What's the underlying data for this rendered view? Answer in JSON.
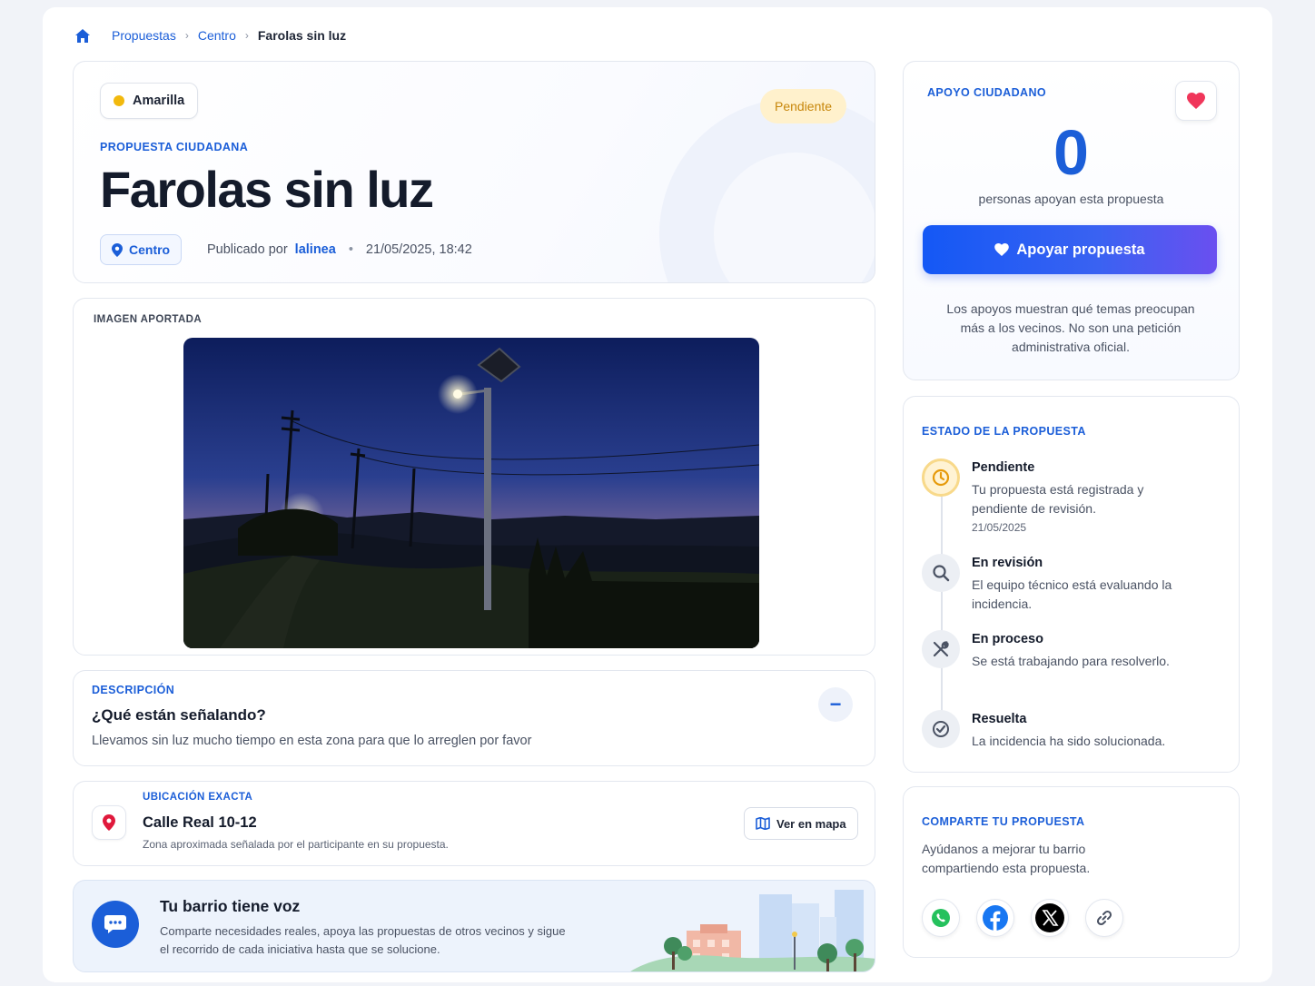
{
  "breadcrumb": {
    "items": [
      "Propuestas",
      "Centro"
    ],
    "current": "Farolas sin luz"
  },
  "proposal": {
    "category": "Amarilla",
    "category_color": "#f2b90d",
    "status_badge": "Pendiente",
    "eyebrow": "PROPUESTA CIUDADANA",
    "title": "Farolas sin luz",
    "district": "Centro",
    "published_prefix": "Publicado por",
    "author": "lalinea",
    "date": "21/05/2025, 18:42"
  },
  "image_section": {
    "eyebrow": "IMAGEN APORTADA"
  },
  "description": {
    "eyebrow": "DESCRIPCIÓN",
    "heading": "¿Qué están señalando?",
    "text": "Llevamos sin luz mucho tiempo en esta zona para que lo arreglen por favor",
    "collapse_label": "−"
  },
  "location": {
    "eyebrow": "UBICACIÓN EXACTA",
    "address": "Calle Real 10-12",
    "note": "Zona aproximada señalada por el participante en su propuesta.",
    "map_button": "Ver en mapa"
  },
  "banner": {
    "title": "Tu barrio tiene voz",
    "text": "Comparte necesidades reales, apoya las propuestas de otros vecinos y sigue el recorrido de cada iniciativa hasta que se solucione."
  },
  "support": {
    "eyebrow": "APOYO CIUDADANO",
    "count": "0",
    "count_label": "personas apoyan esta propuesta",
    "button": "Apoyar propuesta",
    "note": "Los apoyos muestran qué temas preocupan más a los vecinos. No son una petición administrativa oficial."
  },
  "status": {
    "eyebrow": "ESTADO DE LA PROPUESTA",
    "steps": [
      {
        "icon": "clock-icon",
        "title": "Pendiente",
        "desc": "Tu propuesta está registrada y pendiente de revisión.",
        "date": "21/05/2025"
      },
      {
        "icon": "search-icon",
        "title": "En revisión",
        "desc": "El equipo técnico está evaluando la incidencia."
      },
      {
        "icon": "tools-icon",
        "title": "En proceso",
        "desc": "Se está trabajando para resolverlo."
      },
      {
        "icon": "check-circle-icon",
        "title": "Resuelta",
        "desc": "La incidencia ha sido solucionada."
      }
    ]
  },
  "share": {
    "eyebrow": "COMPARTE TU PROPUESTA",
    "text": "Ayúdanos a mejorar tu barrio compartiendo esta propuesta.",
    "networks": [
      "whatsapp-icon",
      "facebook-icon",
      "x-icon",
      "link-icon"
    ]
  },
  "colors": {
    "accent": "#1b5ed8",
    "pending": "#c7860a",
    "heart": "#f0365a"
  }
}
